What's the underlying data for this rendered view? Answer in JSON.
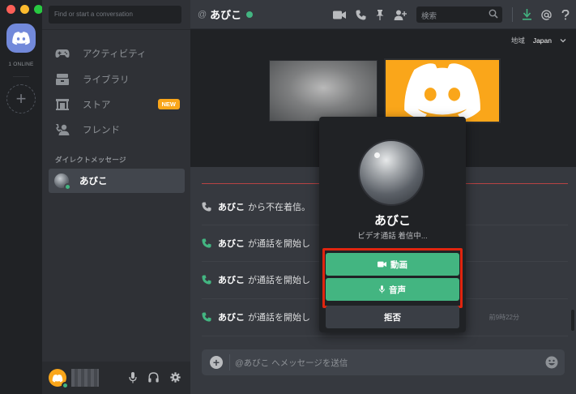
{
  "rail": {
    "online_count": "1 ONLINE",
    "add_server_glyph": "+"
  },
  "sidebar": {
    "search_placeholder": "Find or start a conversation",
    "nav": [
      {
        "label": "アクティビティ",
        "icon": "gamepad-icon"
      },
      {
        "label": "ライブラリ",
        "icon": "library-icon"
      },
      {
        "label": "ストア",
        "icon": "store-icon",
        "badge": "NEW"
      },
      {
        "label": "フレンド",
        "icon": "friends-icon"
      }
    ],
    "dm_header": "ダイレクトメッセージ",
    "dms": [
      {
        "name": "あびこ",
        "status": "online"
      }
    ]
  },
  "topbar": {
    "at": "@",
    "channel_name": "あびこ",
    "search_placeholder": "検索"
  },
  "call": {
    "region_label": "地域",
    "region_value": "Japan"
  },
  "messages": [
    {
      "name": "あびこ",
      "text": "から不在着信。",
      "time": ""
    },
    {
      "name": "あびこ",
      "text": "が通話を開始し",
      "time": ""
    },
    {
      "name": "あびこ",
      "text": "が通話を開始し",
      "time": ""
    },
    {
      "name": "あびこ",
      "text": "が通話を開始し",
      "time": "前9時22分"
    }
  ],
  "composer": {
    "placeholder": "@あびこ へメッセージを送信"
  },
  "incoming_call": {
    "caller_name": "あびこ",
    "status": "ビデオ通話 着信中...",
    "video_label": "動画",
    "voice_label": "音声",
    "decline_label": "拒否"
  },
  "colors": {
    "blurple": "#7289da",
    "green": "#43b581",
    "orange": "#faa61a",
    "highlight_red": "#e0250f"
  }
}
